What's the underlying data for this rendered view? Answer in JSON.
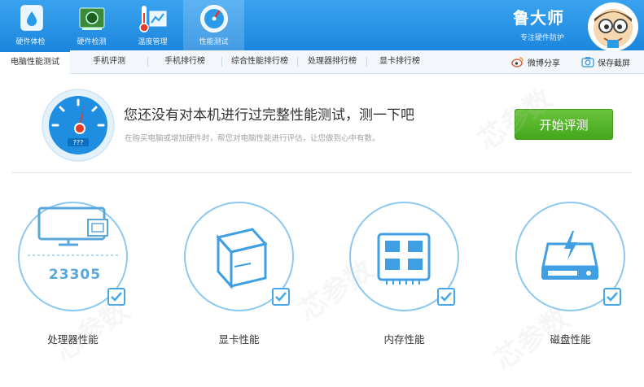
{
  "nav": [
    {
      "label": "硬件体检",
      "icon": "hardware-checkup-icon"
    },
    {
      "label": "硬件检测",
      "icon": "hardware-detect-icon"
    },
    {
      "label": "温度管理",
      "icon": "thermometer-icon"
    },
    {
      "label": "性能测试",
      "icon": "speedometer-icon"
    }
  ],
  "brand": {
    "name": "鲁大师",
    "slogan": "专注硬件防护"
  },
  "tabs": [
    "电脑性能测试",
    "手机评测",
    "手机排行榜",
    "综合性能排行榜",
    "处理器排行榜",
    "显卡排行榜"
  ],
  "tools": {
    "share": "微博分享",
    "screenshot": "保存截屏"
  },
  "prompt": {
    "title": "您还没有对本机进行过完整性能测试，测一下吧",
    "subtitle": "在购买电脑或增加硬件时，帮您对电脑性能进行评估，让您做到心中有数。"
  },
  "start_button": "开始评测",
  "gauge_text": "???",
  "cards": [
    {
      "label": "处理器性能",
      "icon": "monitor-cpu-icon",
      "score": "23305"
    },
    {
      "label": "显卡性能",
      "icon": "gpu-cube-icon"
    },
    {
      "label": "内存性能",
      "icon": "memory-chip-icon"
    },
    {
      "label": "磁盘性能",
      "icon": "disk-drive-icon"
    }
  ],
  "watermark": "芯参数",
  "colors": {
    "accent": "#1c86dd",
    "button": "#4db022",
    "card_line": "#46a8ea"
  }
}
